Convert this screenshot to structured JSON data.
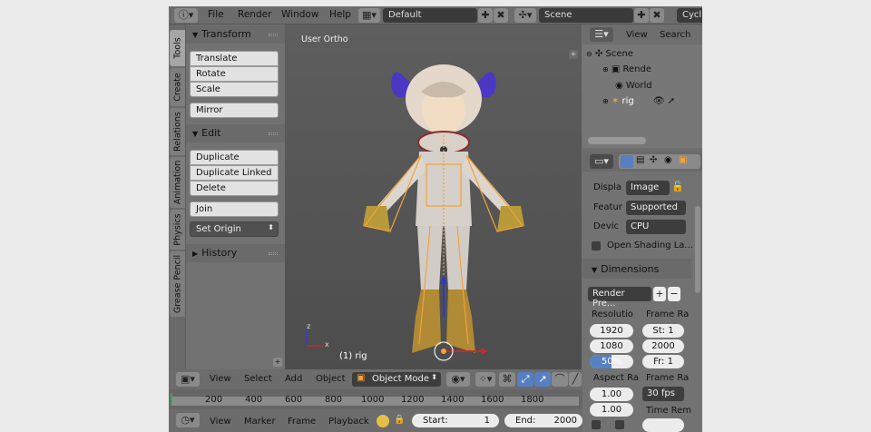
{
  "topbar": {
    "menus": [
      "File",
      "Render",
      "Window",
      "Help"
    ],
    "layout_value": "Default",
    "scene_value": "Scene",
    "engine_value": "Cycl"
  },
  "tool_tabs": [
    "Tools",
    "Create",
    "Relations",
    "Animation",
    "Physics",
    "Grease Pencil"
  ],
  "tool_panel": {
    "transform_header": "Transform",
    "transform_buttons": [
      "Translate",
      "Rotate",
      "Scale"
    ],
    "mirror": "Mirror",
    "edit_header": "Edit",
    "edit_buttons": [
      "Duplicate",
      "Duplicate Linked",
      "Delete"
    ],
    "join": "Join",
    "set_origin": "Set Origin",
    "history_header": "History"
  },
  "viewport": {
    "view_label": "User Ortho",
    "object_label": "(1) rig",
    "axis_x": "x",
    "axis_z": "z"
  },
  "view3d_header": {
    "menus": [
      "View",
      "Select",
      "Add",
      "Object"
    ],
    "mode": "Object Mode"
  },
  "timeline": {
    "ticks": [
      "200",
      "400",
      "600",
      "800",
      "1000",
      "1200",
      "1400",
      "1600",
      "1800"
    ]
  },
  "timeline_header": {
    "menus": [
      "View",
      "Marker",
      "Frame",
      "Playback"
    ],
    "start_label": "Start:",
    "start_value": "1",
    "end_label": "End:",
    "end_value": "2000"
  },
  "outliner": {
    "view": "View",
    "search": "Search",
    "items": [
      {
        "label": "Scene",
        "icon": "scene-icon"
      },
      {
        "label": "Rende",
        "icon": "render-layers-icon"
      },
      {
        "label": "World",
        "icon": "world-icon"
      },
      {
        "label": "rig",
        "icon": "armature-icon"
      }
    ]
  },
  "properties": {
    "display_label": "Displa",
    "display_value": "Image",
    "feature_label": "Featur",
    "feature_value": "Supported",
    "device_label": "Devic",
    "device_value": "CPU",
    "open_shading": "Open Shading La...",
    "dimensions_header": "Dimensions",
    "render_presets": "Render Pre...",
    "resolution_label": "Resolutio",
    "res_x": "1920",
    "res_y": "1080",
    "res_pct": "50%",
    "res_pct_fraction": 0.5,
    "frame_range_label": "Frame Ra",
    "frame_start": "St:  1",
    "frame_end": "2000",
    "frame_step": "Fr:  1",
    "aspect_label": "Aspect Ra",
    "aspect_x": "1.00",
    "aspect_y": "1.00",
    "frame_rate_label": "Frame Ra",
    "frame_rate_value": "30 fps",
    "time_remap_label": "Time Rem"
  },
  "colors": {
    "accent_blue": "#5680c2",
    "armature_orange": "#f2a23a"
  }
}
